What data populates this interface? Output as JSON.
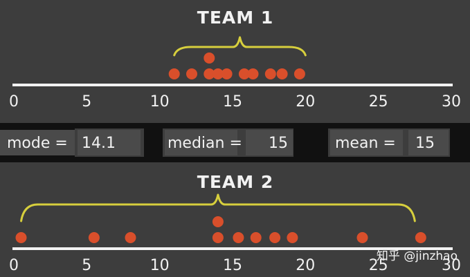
{
  "chart_data": [
    {
      "type": "scatter",
      "title": "TEAM 1",
      "xlim": [
        0,
        30
      ],
      "ticks": [
        "0",
        "5",
        "10",
        "15",
        "20",
        "25",
        "30"
      ],
      "points": [
        {
          "x": 11,
          "stack": 0
        },
        {
          "x": 12.2,
          "stack": 0
        },
        {
          "x": 13.4,
          "stack": 0
        },
        {
          "x": 13.4,
          "stack": 1
        },
        {
          "x": 14,
          "stack": 0
        },
        {
          "x": 14.6,
          "stack": 0
        },
        {
          "x": 15.8,
          "stack": 0
        },
        {
          "x": 16.4,
          "stack": 0
        },
        {
          "x": 17.6,
          "stack": 0
        },
        {
          "x": 18.4,
          "stack": 0
        },
        {
          "x": 19.6,
          "stack": 0
        }
      ],
      "brace_range": [
        11,
        20
      ]
    },
    {
      "type": "scatter",
      "title": "TEAM 2",
      "xlim": [
        0,
        30
      ],
      "ticks": [
        "0",
        "5",
        "10",
        "15",
        "20",
        "25",
        "30"
      ],
      "points": [
        {
          "x": 0.5,
          "stack": 0
        },
        {
          "x": 5.5,
          "stack": 0
        },
        {
          "x": 8,
          "stack": 0
        },
        {
          "x": 14,
          "stack": 0
        },
        {
          "x": 14,
          "stack": 1
        },
        {
          "x": 15.4,
          "stack": 0
        },
        {
          "x": 16.6,
          "stack": 0
        },
        {
          "x": 17.9,
          "stack": 0
        },
        {
          "x": 19.1,
          "stack": 0
        },
        {
          "x": 23.9,
          "stack": 0
        },
        {
          "x": 27.9,
          "stack": 0
        }
      ],
      "brace_range": [
        0.5,
        27.5
      ]
    }
  ],
  "stats": [
    {
      "label": "mode =",
      "value": "14.1"
    },
    {
      "label": "median =",
      "value": "15"
    },
    {
      "label": "mean =",
      "value": "15"
    }
  ],
  "watermark": "知乎 @jinzhao",
  "colors": {
    "background": "#3d3d3d",
    "dot": "#d94f2b",
    "brace": "#d7cf3d",
    "axis": "#f2f2f2"
  }
}
